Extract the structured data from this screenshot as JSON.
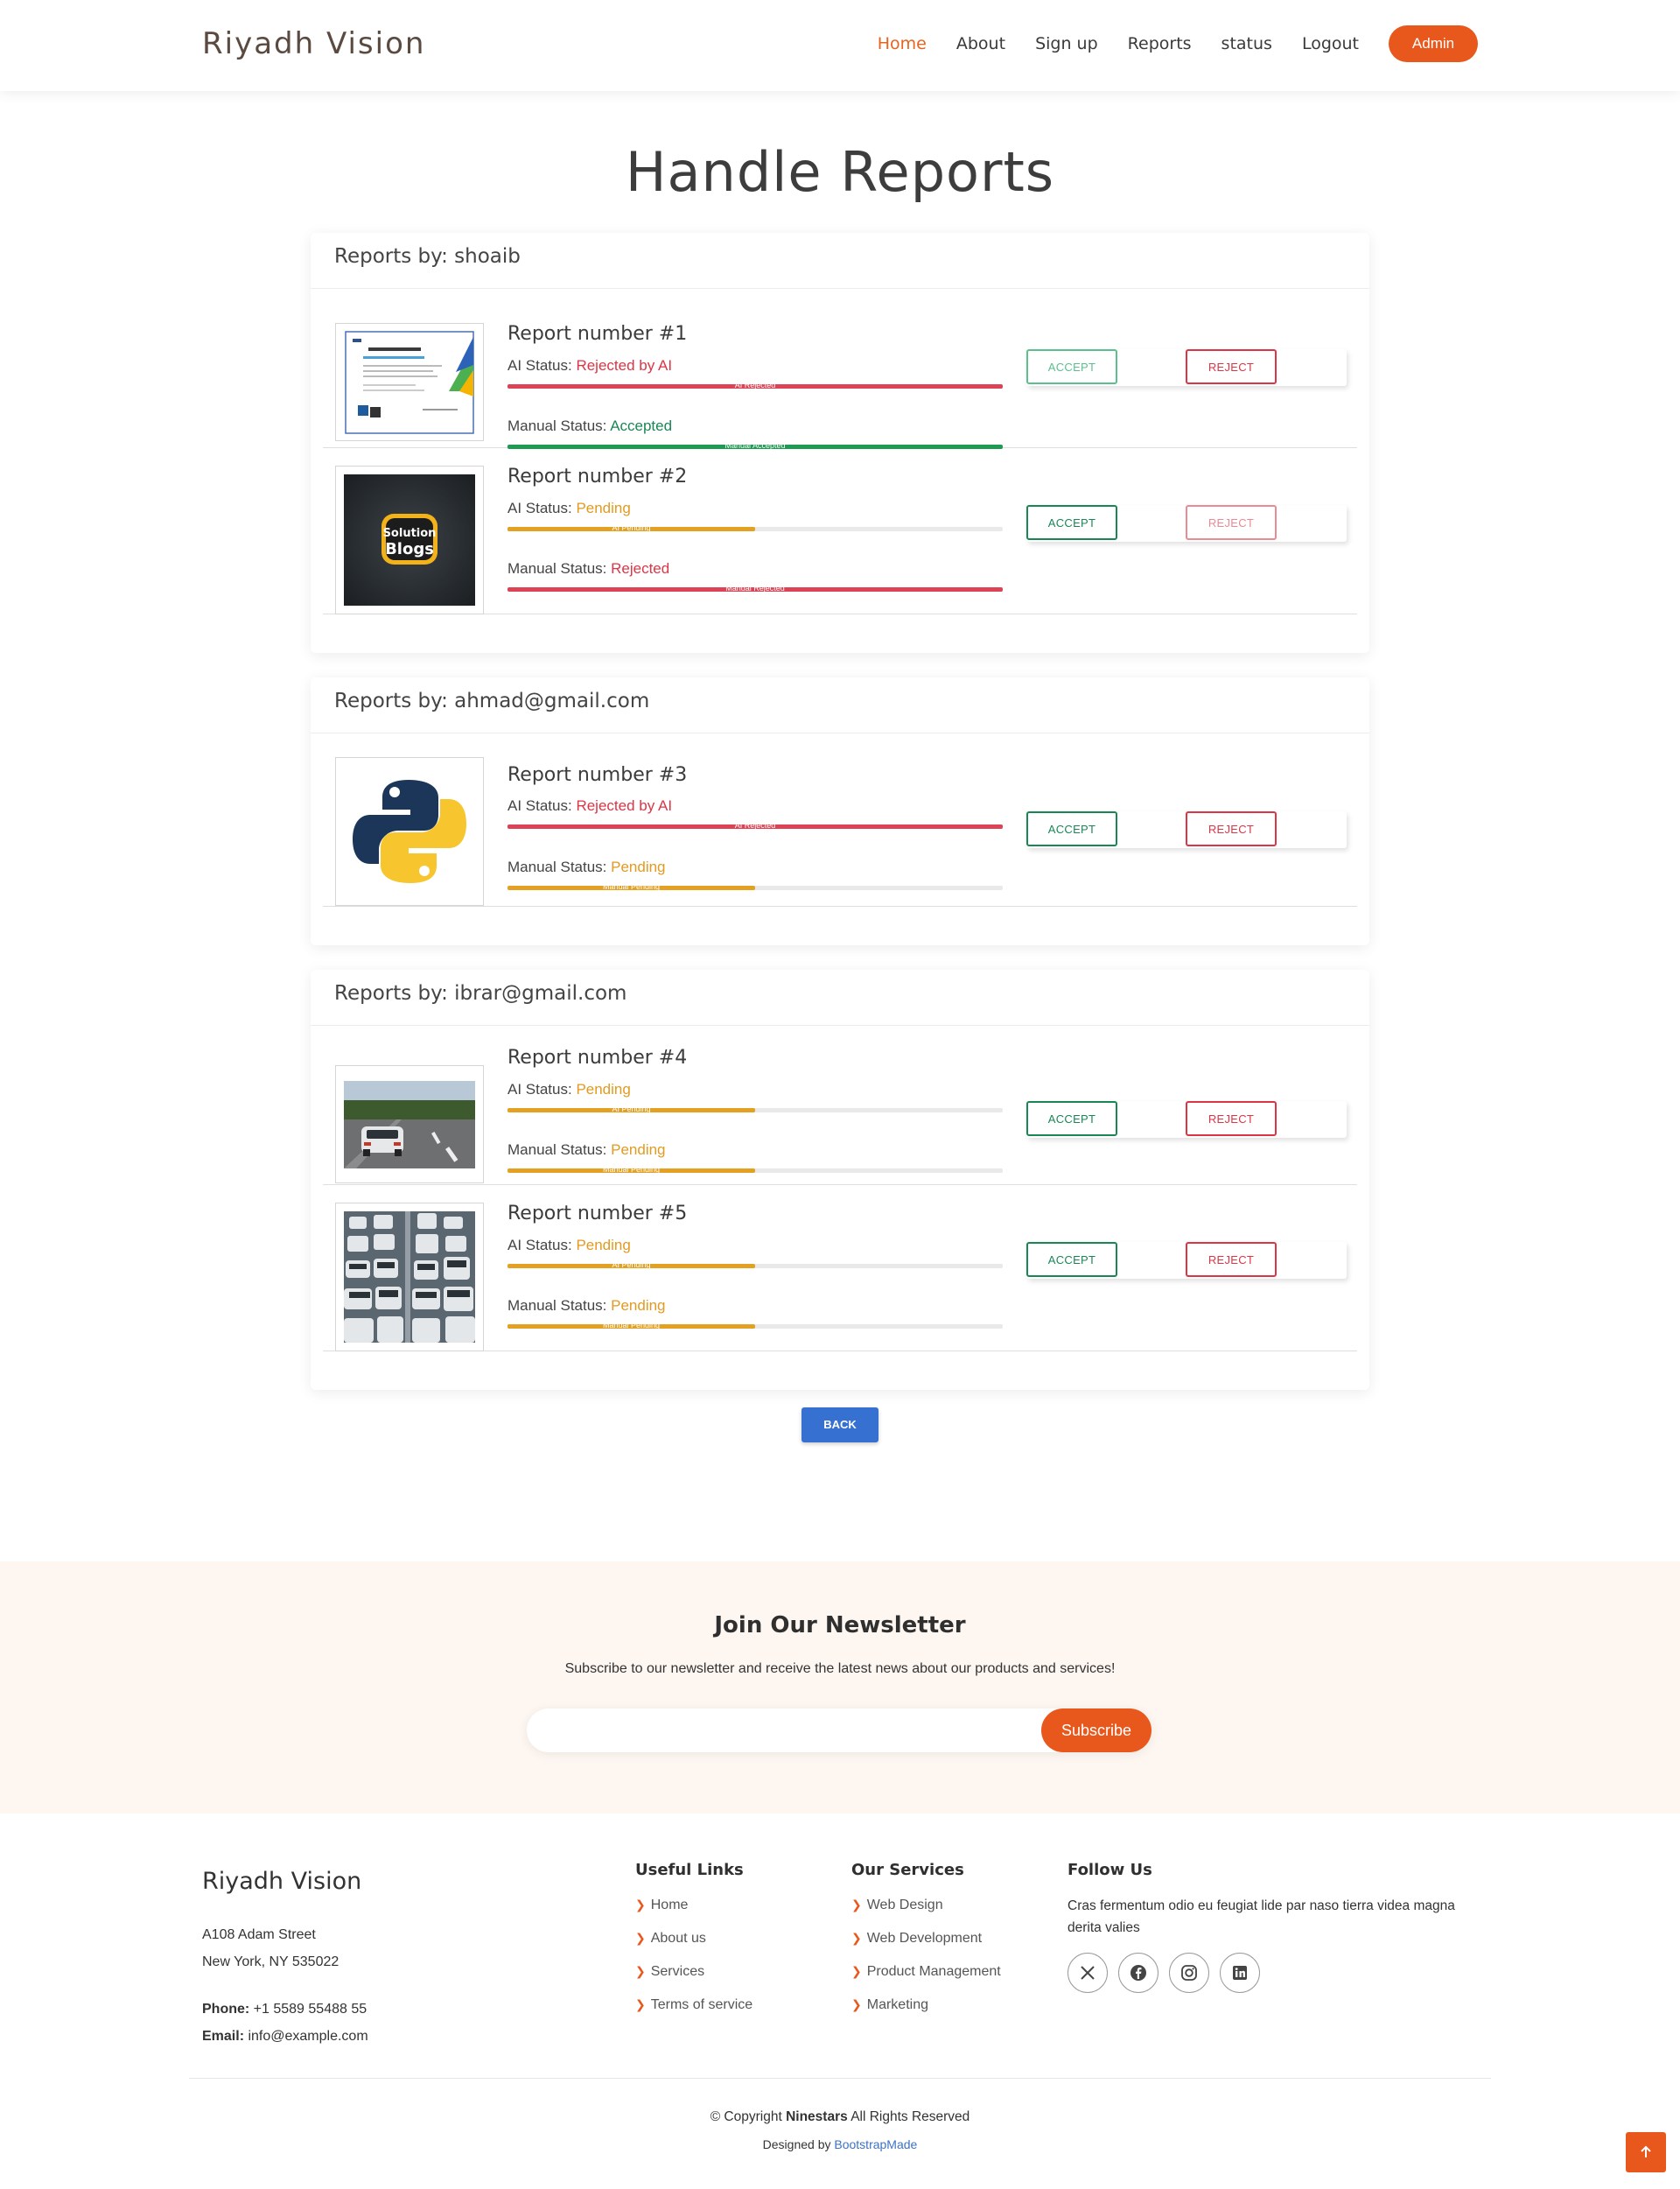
{
  "header": {
    "brand": "Riyadh Vision",
    "nav": [
      "Home",
      "About",
      "Sign up",
      "Reports",
      "status",
      "Logout"
    ],
    "admin_label": "Admin"
  },
  "page_title": "Handle Reports",
  "labels": {
    "ai_status": "AI Status: ",
    "manual_status": "Manual Status: ",
    "accept": "ACCEPT",
    "reject": "REJECT",
    "back": "BACK"
  },
  "groups": [
    {
      "header": "Reports by: shoaib",
      "reports": [
        {
          "title": "Report number #1",
          "ai_status": "Rejected by AI",
          "ai_bar_label": "AI Rejected",
          "ai_progress": 1.0,
          "manual_status": "Accepted",
          "manual_bar_label": "Manual Accepted",
          "manual_progress": 1.0,
          "thumb": "certificate"
        },
        {
          "title": "Report number #2",
          "ai_status": "Pending",
          "ai_bar_label": "AI Pending",
          "ai_progress": 0.5,
          "manual_status": "Rejected",
          "manual_bar_label": "Manual Rejected",
          "manual_progress": 1.0,
          "thumb": "solution-blogs"
        }
      ]
    },
    {
      "header": "Reports by: ahmad@gmail.com",
      "reports": [
        {
          "title": "Report number #3",
          "ai_status": "Rejected by AI",
          "ai_bar_label": "AI Rejected",
          "ai_progress": 1.0,
          "manual_status": "Pending",
          "manual_bar_label": "Manual Pending",
          "manual_progress": 0.5,
          "thumb": "python-logo"
        }
      ]
    },
    {
      "header": "Reports by: ibrar@gmail.com",
      "reports": [
        {
          "title": "Report number #4",
          "ai_status": "Pending",
          "ai_bar_label": "AI Pending",
          "ai_progress": 0.5,
          "manual_status": "Pending",
          "manual_bar_label": "Manual Pending",
          "manual_progress": 0.5,
          "thumb": "car-road"
        },
        {
          "title": "Report number #5",
          "ai_status": "Pending",
          "ai_bar_label": "AI Pending",
          "ai_progress": 0.5,
          "manual_status": "Pending",
          "manual_bar_label": "Manual Pending",
          "manual_progress": 0.5,
          "thumb": "traffic-jam"
        }
      ]
    }
  ],
  "newsletter": {
    "title": "Join Our Newsletter",
    "text": "Subscribe to our newsletter and receive the latest news about our products and services!",
    "input_value": "",
    "button": "Subscribe"
  },
  "footer": {
    "brand": "Riyadh Vision",
    "address_line1": "A108 Adam Street",
    "address_line2": "New York, NY 535022",
    "phone_label": "Phone:",
    "phone": " +1 5589 55488 55",
    "email_label": "Email:",
    "email": " info@example.com",
    "useful_links_title": "Useful Links",
    "useful_links": [
      "Home",
      "About us",
      "Services",
      "Terms of service"
    ],
    "services_title": "Our Services",
    "services": [
      "Web Design",
      "Web Development",
      "Product Management",
      "Marketing"
    ],
    "follow_title": "Follow Us",
    "follow_text": "Cras fermentum odio eu feugiat lide par naso tierra videa magna derita valies",
    "socials": [
      "x-icon",
      "facebook-icon",
      "instagram-icon",
      "linkedin-icon"
    ],
    "copyright_prefix": "© Copyright ",
    "copyright_brand": "Ninestars",
    "copyright_suffix": " All Rights Reserved",
    "designed_prefix": "Designed by ",
    "designed_link": "BootstrapMade"
  },
  "colors": {
    "accent": "#e8581c",
    "danger": "#dc3545",
    "success": "#198754",
    "warning": "#e39a1f",
    "primary": "#3671d1"
  }
}
